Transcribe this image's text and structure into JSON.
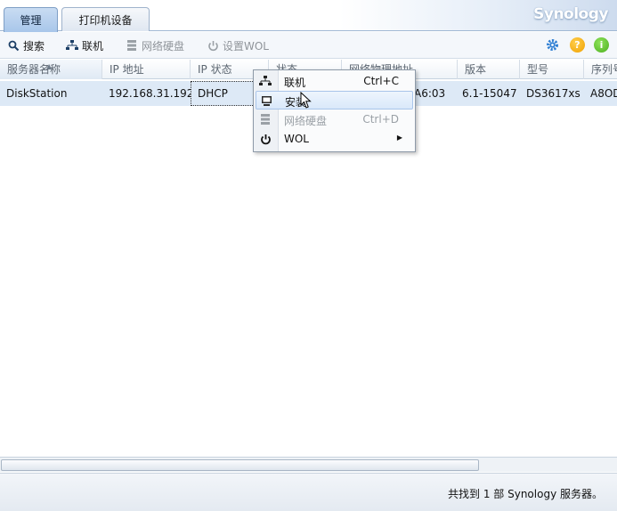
{
  "header": {
    "tabs": [
      {
        "label": "管理",
        "active": true
      },
      {
        "label": "打印机设备",
        "active": false
      }
    ],
    "logo": "Synology"
  },
  "toolbar": {
    "search": "搜索",
    "connect": "联机",
    "network_drive": "网络硬盘",
    "set_wol": "设置WOL"
  },
  "grid": {
    "columns": [
      "服务器名称",
      "IP 地址",
      "IP 状态",
      "状态",
      "网络物理地址",
      "版本",
      "型号",
      "序列号"
    ],
    "rows": [
      {
        "server_name": "DiskStation",
        "ip": "192.168.31.192",
        "ip_status": "DHCP",
        "mac_partial": "A6:03",
        "version": "6.1-15047",
        "model": "DS3617xs",
        "serial": "A8OD"
      }
    ]
  },
  "context_menu": {
    "items": [
      {
        "label": "联机",
        "shortcut": "Ctrl+C",
        "state": "normal"
      },
      {
        "label": "安装",
        "shortcut": "",
        "state": "hover"
      },
      {
        "label": "网络硬盘",
        "shortcut": "Ctrl+D",
        "state": "disabled"
      },
      {
        "label": "WOL",
        "shortcut": "",
        "state": "submenu"
      }
    ]
  },
  "status": {
    "text": "共找到 1 部 Synology 服务器。"
  },
  "colors": {
    "accent_tab": "#a8c6ea",
    "selected_row": "#dde9f6",
    "settings_icon": "#2f7fd3",
    "help_icon": "#f0a000",
    "info_icon": "#4caf1e"
  }
}
